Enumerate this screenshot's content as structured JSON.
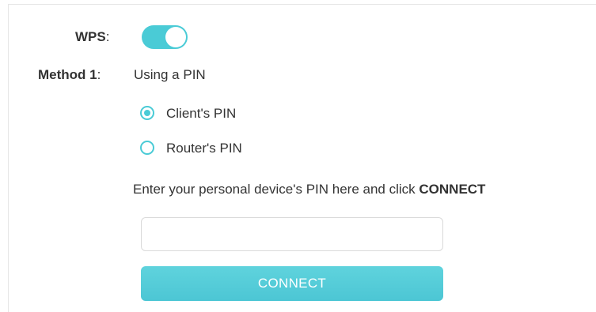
{
  "wps": {
    "label": "WPS",
    "colon": ":",
    "enabled": true,
    "accent_color": "#4acbd6"
  },
  "method1": {
    "label": "Method 1",
    "colon": ":",
    "value": "Using a PIN"
  },
  "pin_options": [
    {
      "label": "Client's PIN",
      "selected": true
    },
    {
      "label": "Router's PIN",
      "selected": false
    }
  ],
  "instruction": {
    "text": "Enter your personal device's PIN here and click",
    "emphasis": "CONNECT"
  },
  "pin_input": {
    "value": "",
    "placeholder": ""
  },
  "connect_button": {
    "label": "CONNECT"
  }
}
